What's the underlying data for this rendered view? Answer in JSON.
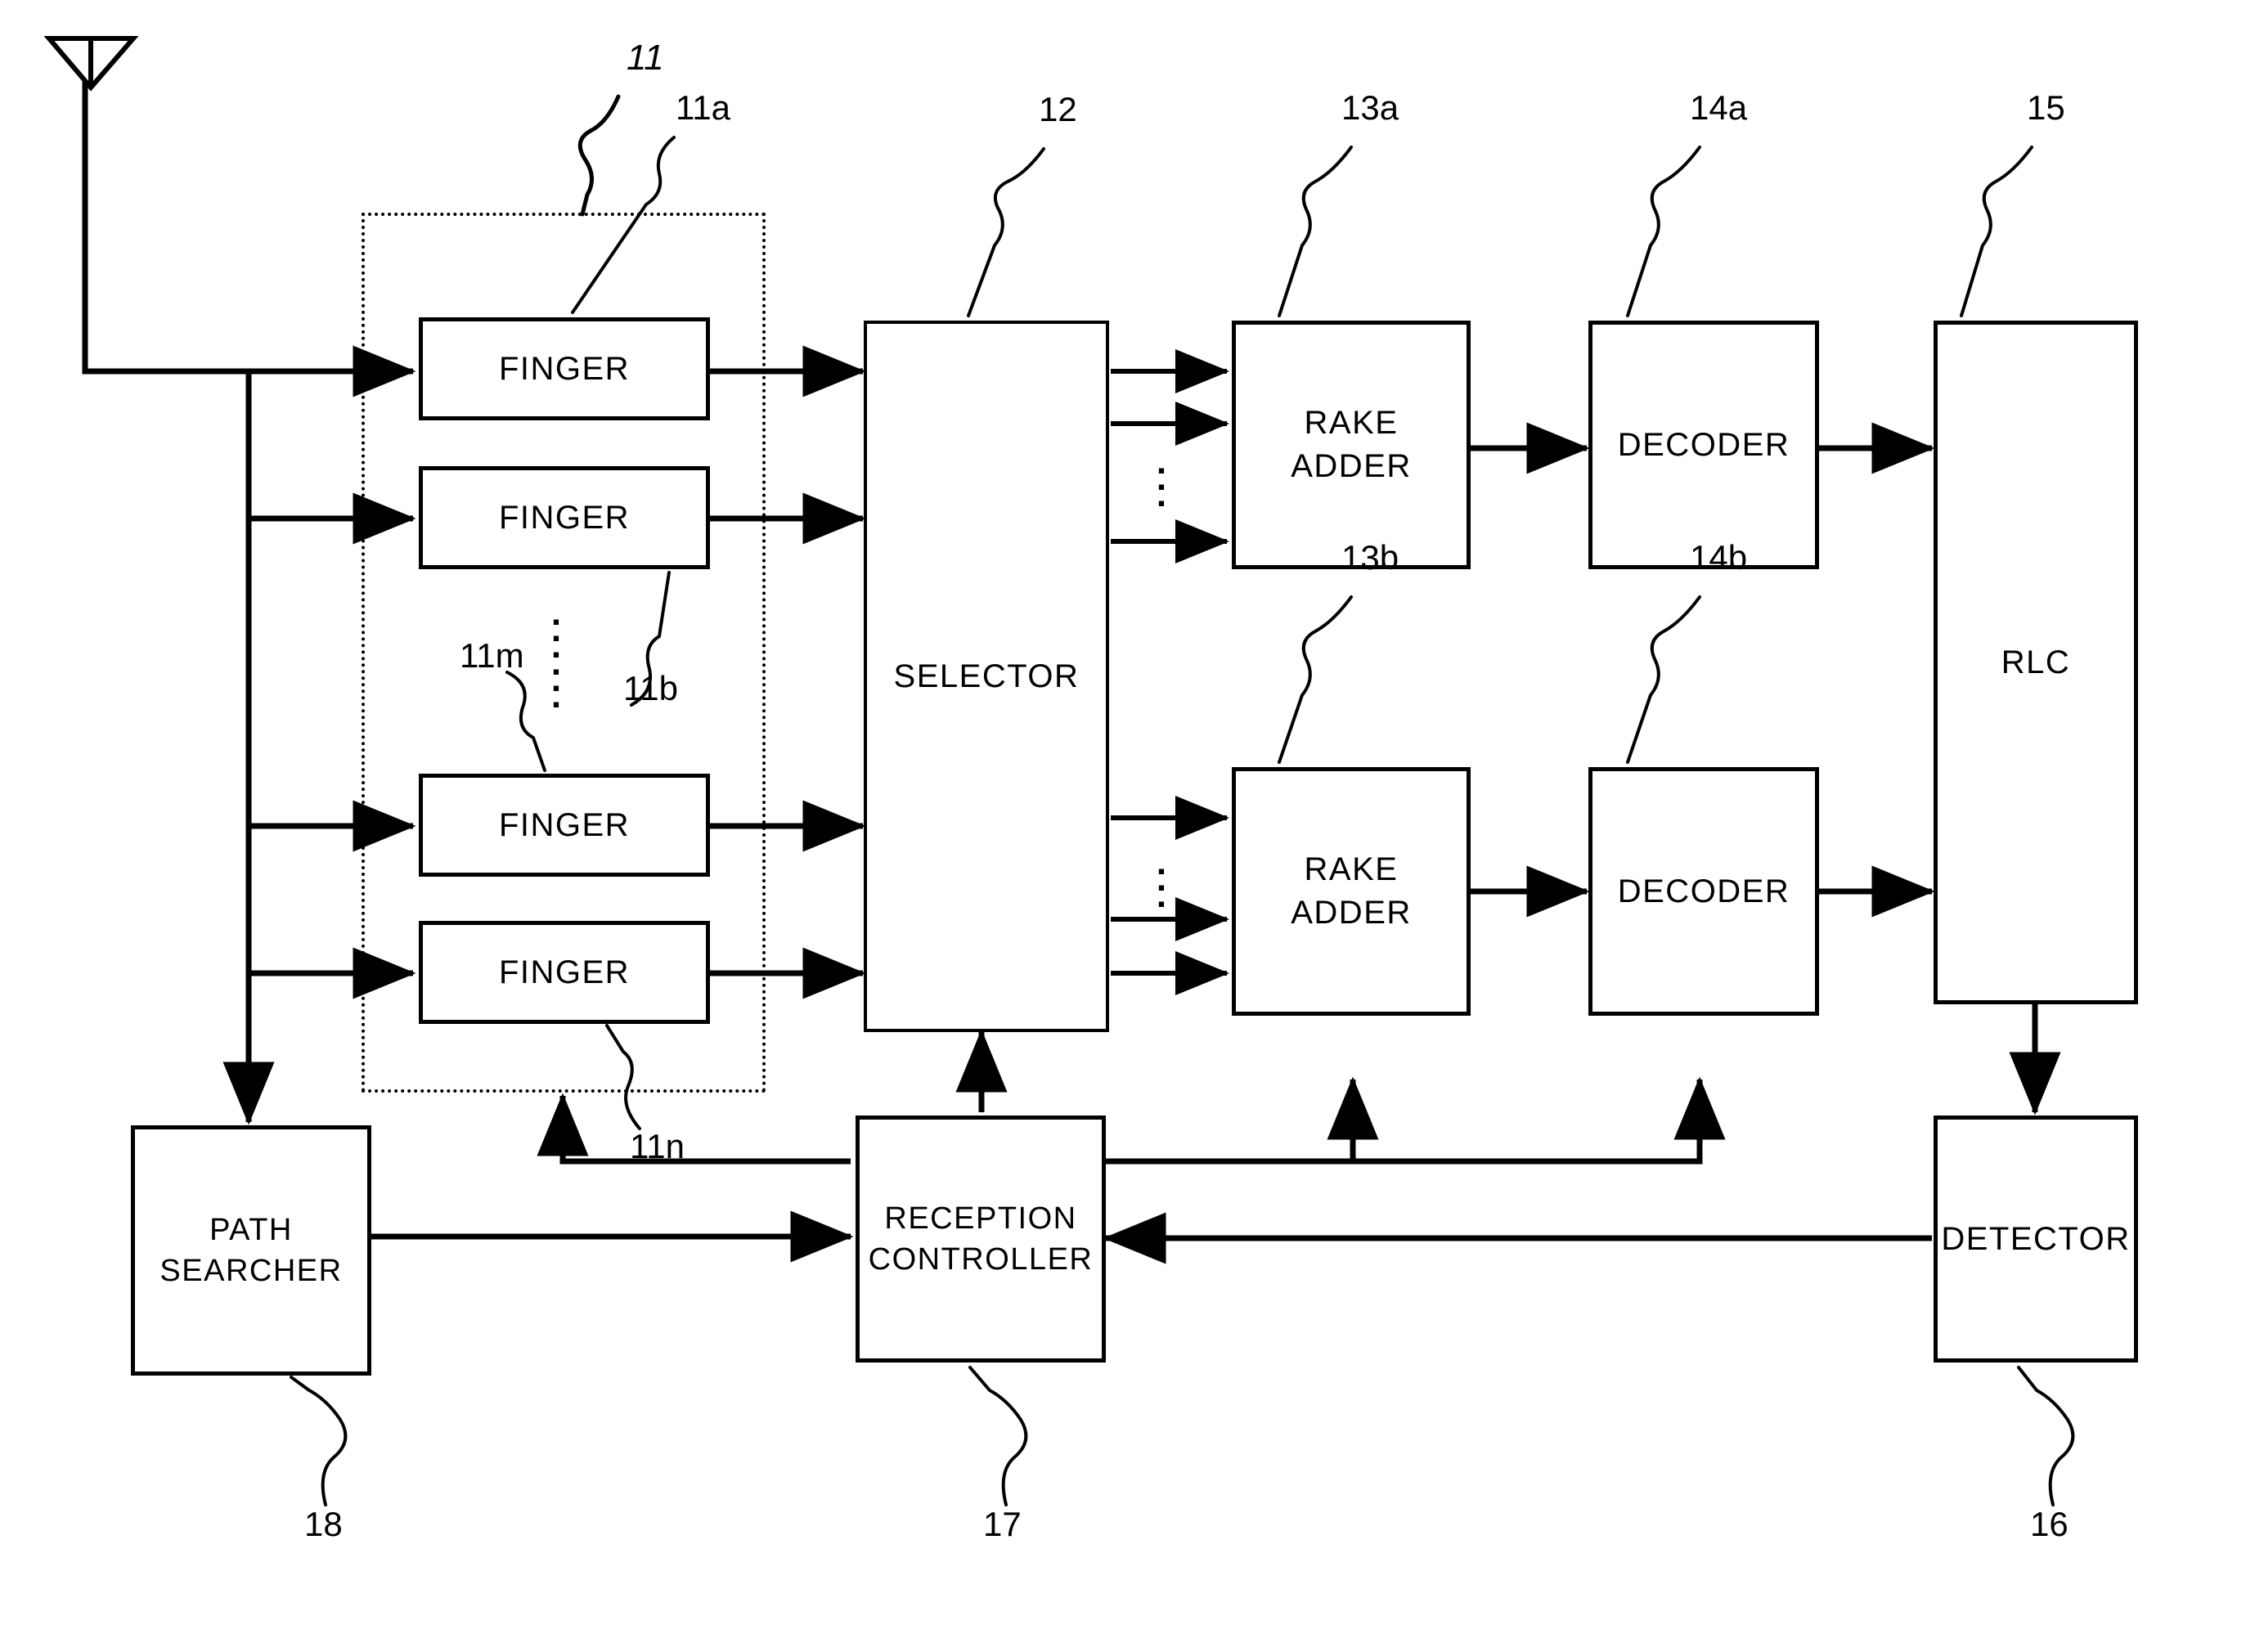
{
  "figure": {
    "type": "patent-block-diagram",
    "description": "CDMA RAKE receiver block diagram",
    "antenna": {
      "icon": "antenna-icon"
    }
  },
  "blocks": [
    {
      "id": "finger-a",
      "label": "FINGER",
      "ref": "11a"
    },
    {
      "id": "finger-b",
      "label": "FINGER",
      "ref": "11b"
    },
    {
      "id": "finger-m",
      "label": "FINGER",
      "ref": "11m"
    },
    {
      "id": "finger-n",
      "label": "FINGER",
      "ref": "11n"
    },
    {
      "id": "selector",
      "label": "SELECTOR",
      "ref": "12"
    },
    {
      "id": "rake-a",
      "label": "RAKE\nADDER",
      "ref": "13a"
    },
    {
      "id": "rake-b",
      "label": "RAKE\nADDER",
      "ref": "13b"
    },
    {
      "id": "decoder-a",
      "label": "DECODER",
      "ref": "14a"
    },
    {
      "id": "decoder-b",
      "label": "DECODER",
      "ref": "14b"
    },
    {
      "id": "rlc",
      "label": "RLC",
      "ref": "15"
    },
    {
      "id": "detector",
      "label": "DETECTOR",
      "ref": "16"
    },
    {
      "id": "reception",
      "label": "RECEPTION\nCONTROLLER",
      "ref": "17"
    },
    {
      "id": "path",
      "label": "PATH\nSEARCHER",
      "ref": "18"
    }
  ],
  "group": {
    "id": "finger-group",
    "ref": "11"
  },
  "refs": {
    "group_11": "11",
    "finger_a": "11a",
    "finger_b": "11b",
    "finger_m": "11m",
    "finger_n": "11n",
    "selector": "12",
    "rake_a": "13a",
    "rake_b": "13b",
    "decoder_a": "14a",
    "decoder_b": "14b",
    "rlc": "15",
    "detector": "16",
    "reception_controller": "17",
    "path_searcher": "18"
  },
  "labels": {
    "finger": "FINGER",
    "selector": "SELECTOR",
    "rake_adder": "RAKE\nADDER",
    "decoder": "DECODER",
    "rlc": "RLC",
    "detector": "DETECTOR",
    "reception_controller": "RECEPTION\nCONTROLLER",
    "path_searcher": "PATH\nSEARCHER",
    "vertical_ellipsis": "·\n·\n·"
  },
  "colors": {
    "line": "#000000",
    "background": "#ffffff"
  }
}
